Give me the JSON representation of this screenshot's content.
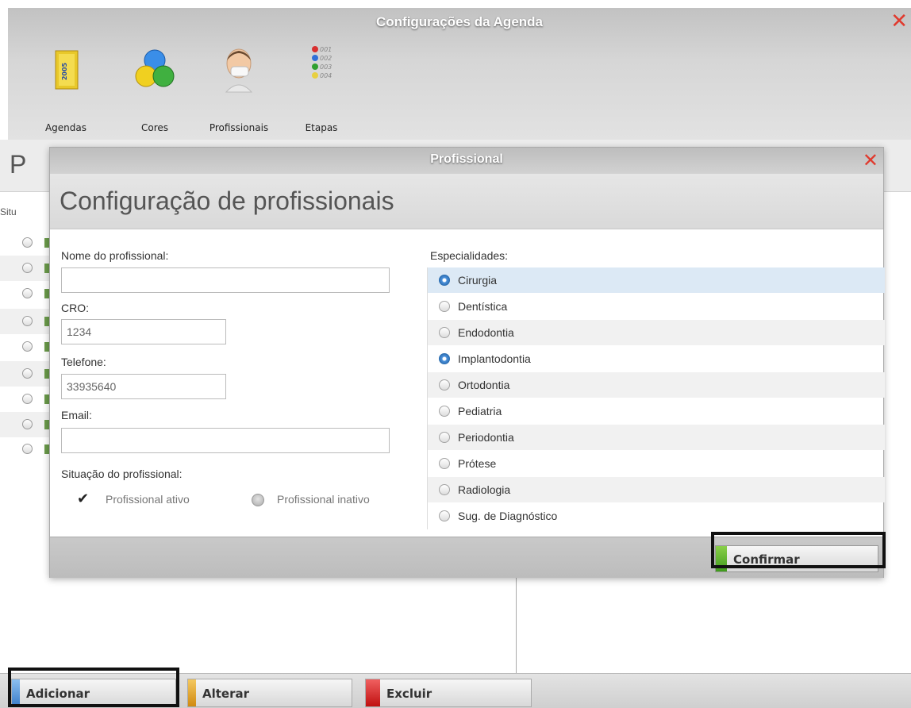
{
  "window": {
    "title": "Configurações da Agenda",
    "close_glyph": "✕"
  },
  "toolbar": [
    {
      "label": "Agendas",
      "icon": "calendar-2005-icon"
    },
    {
      "label": "Cores",
      "icon": "color-circles-icon"
    },
    {
      "label": "Profissionais",
      "icon": "dentist-person-icon"
    },
    {
      "label": "Etapas",
      "icon": "stage-list-icon"
    }
  ],
  "etapas_icon_codes": [
    "001",
    "002",
    "003",
    "004"
  ],
  "background": {
    "title_letter": "P",
    "situ_label": "Situ"
  },
  "modal": {
    "title": "Profissional",
    "close_glyph": "✕",
    "heading": "Configuração de profissionais",
    "fields": {
      "name_label": "Nome do profissional:",
      "name_value": "",
      "cro_label": "CRO:",
      "cro_value": "1234",
      "phone_label": "Telefone:",
      "phone_value": "33935640",
      "email_label": "Email:",
      "email_value": ""
    },
    "status": {
      "label": "Situação do profissional:",
      "active_label": "Profissional ativo",
      "inactive_label": "Profissional inativo",
      "selected": "active"
    },
    "specialties_label": "Especialidades:",
    "specialties": [
      {
        "label": "Cirurgia",
        "selected": true
      },
      {
        "label": "Dentística",
        "selected": false
      },
      {
        "label": "Endodontia",
        "selected": false
      },
      {
        "label": "Implantodontia",
        "selected": true
      },
      {
        "label": "Ortodontia",
        "selected": false
      },
      {
        "label": "Pediatria",
        "selected": false
      },
      {
        "label": "Periodontia",
        "selected": false
      },
      {
        "label": "Prótese",
        "selected": false
      },
      {
        "label": "Radiologia",
        "selected": false
      },
      {
        "label": "Sug. de Diagnóstico",
        "selected": false
      }
    ],
    "confirm_label": "Confirmar"
  },
  "bottom_buttons": {
    "add_label": "Adicionar",
    "edit_label": "Alterar",
    "delete_label": "Excluir"
  },
  "colors": {
    "close_red": "#e03a2e",
    "add_stripe": "#4a90d9",
    "edit_stripe": "#e0a020",
    "delete_stripe": "#d62020",
    "confirm_stripe": "#5cb531",
    "selected_row": "#dce9f5"
  }
}
